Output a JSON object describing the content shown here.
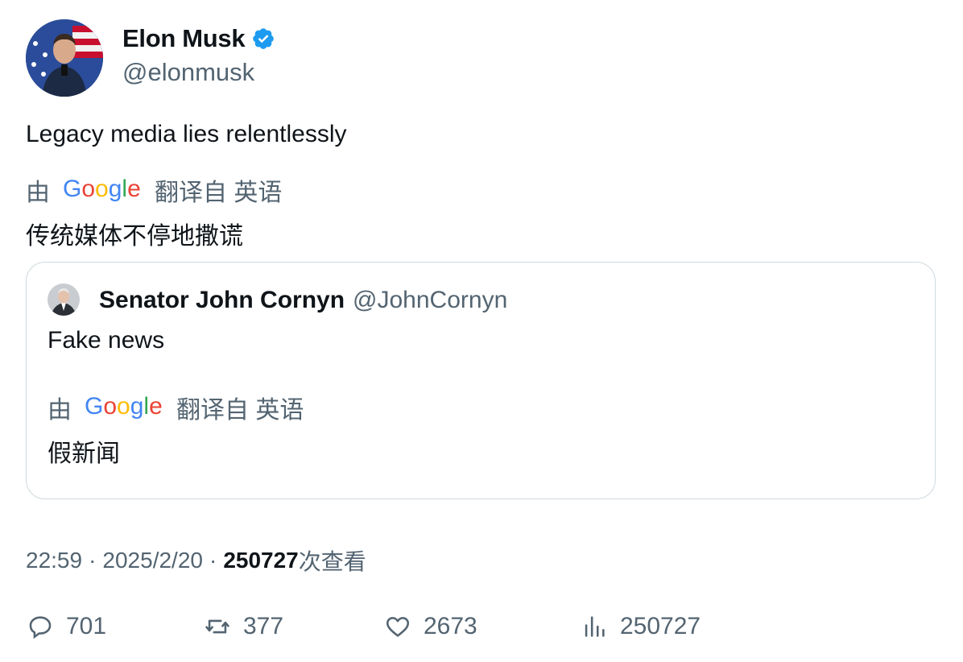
{
  "author": {
    "display_name": "Elon Musk",
    "handle": "@elonmusk",
    "verified": true,
    "verified_color": "#1d9bf0"
  },
  "tweet": {
    "text": "Legacy media lies relentlessly",
    "translation": {
      "prefix": "由",
      "provider": "Google",
      "suffix": "翻译自 英语",
      "text": "传统媒体不停地撒谎"
    }
  },
  "quoted_tweet": {
    "display_name": "Senator John Cornyn",
    "handle": "@JohnCornyn",
    "text": "Fake news",
    "translation": {
      "prefix": "由",
      "provider": "Google",
      "suffix": "翻译自 英语",
      "text": "假新闻"
    }
  },
  "meta": {
    "time": "22:59",
    "separator": "·",
    "date": "2025/2/20",
    "views": "250727",
    "views_label": "次查看"
  },
  "actions": {
    "replies": "701",
    "retweets": "377",
    "likes": "2673",
    "views": "250727"
  },
  "icons": {
    "reply": "reply-icon",
    "retweet": "retweet-icon",
    "like": "heart-icon",
    "analytics": "analytics-icon",
    "verified": "verified-badge-icon"
  },
  "colors": {
    "text_primary": "#0f1419",
    "text_secondary": "#536471",
    "border": "#cfd9de"
  }
}
